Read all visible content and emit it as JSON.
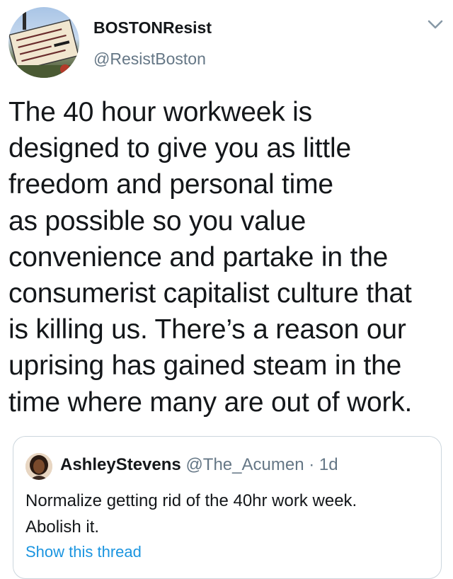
{
  "author": {
    "name": "BOSTONResist",
    "handle": "@ResistBoston",
    "avatar_icon": "protest-sign-avatar"
  },
  "tweet": {
    "lines": [
      "The 40 hour workweek is",
      "designed to give you as little",
      "freedom and personal time",
      "as possible so you value",
      "convenience and partake in the",
      "consumerist capitalist culture that",
      "is killing us. There’s a reason our",
      "uprising has gained steam in the",
      "time where many are out of work."
    ]
  },
  "quote": {
    "name": "AshleyStevens",
    "handle": "@The_Acumen",
    "separator": " · ",
    "time": "1d",
    "lines": [
      "Normalize getting rid of the 40hr work week.",
      "Abolish it."
    ],
    "show_thread": "Show this thread"
  },
  "colors": {
    "text": "#14171a",
    "secondary": "#657786",
    "link": "#1b95e0",
    "border": "#ccd6dd"
  },
  "icons": {
    "menu": "chevron-down-icon"
  }
}
